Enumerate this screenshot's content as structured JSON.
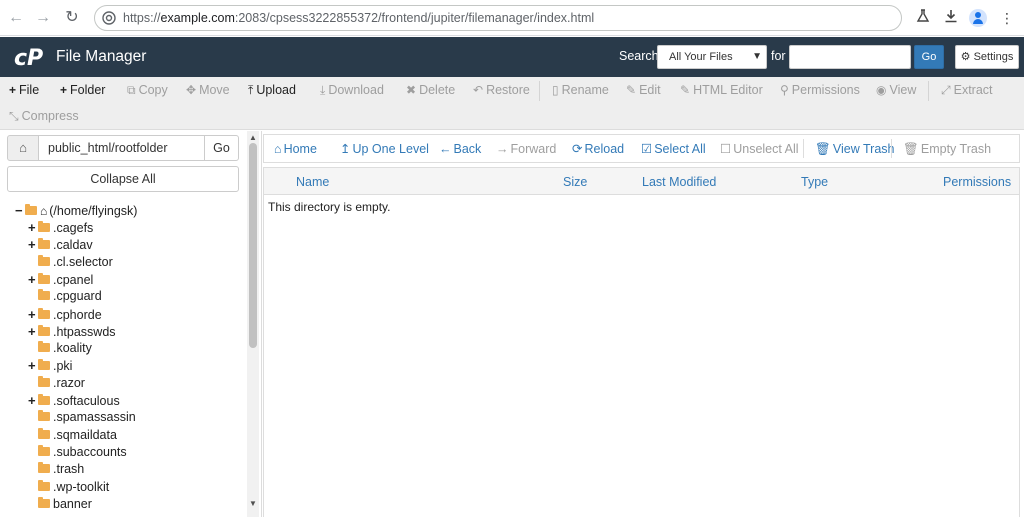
{
  "browser": {
    "url_prefix": "https://",
    "url_host": "example.com",
    "url_rest": ":2083/cpsess3222855372/frontend/jupiter/filemanager/index.html"
  },
  "header": {
    "title": "File Manager",
    "search_label": "Search",
    "search_scope": "All Your Files",
    "for_label": "for",
    "search_value": "",
    "go_label": "Go",
    "settings_label": "Settings"
  },
  "toolbar": {
    "file": "File",
    "folder": "Folder",
    "copy": "Copy",
    "move": "Move",
    "upload": "Upload",
    "download": "Download",
    "delete": "Delete",
    "restore": "Restore",
    "rename": "Rename",
    "edit": "Edit",
    "html_editor": "HTML Editor",
    "permissions": "Permissions",
    "view": "View",
    "extract": "Extract",
    "compress": "Compress"
  },
  "sidebar": {
    "path_value": "public_html/rootfolder",
    "go_label": "Go",
    "collapse_all": "Collapse All",
    "root": "(/home/flyingsk)",
    "items": [
      {
        "label": ".cagefs",
        "expandable": true
      },
      {
        "label": ".caldav",
        "expandable": true
      },
      {
        "label": ".cl.selector",
        "expandable": false
      },
      {
        "label": ".cpanel",
        "expandable": true
      },
      {
        "label": ".cpguard",
        "expandable": false
      },
      {
        "label": ".cphorde",
        "expandable": true
      },
      {
        "label": ".htpasswds",
        "expandable": true
      },
      {
        "label": ".koality",
        "expandable": false
      },
      {
        "label": ".pki",
        "expandable": true
      },
      {
        "label": ".razor",
        "expandable": false
      },
      {
        "label": ".softaculous",
        "expandable": true
      },
      {
        "label": ".spamassassin",
        "expandable": false
      },
      {
        "label": ".sqmaildata",
        "expandable": false
      },
      {
        "label": ".subaccounts",
        "expandable": false
      },
      {
        "label": ".trash",
        "expandable": false
      },
      {
        "label": ".wp-toolkit",
        "expandable": false
      },
      {
        "label": "banner",
        "expandable": false
      }
    ]
  },
  "navbar": {
    "home": "Home",
    "up_one_level": "Up One Level",
    "back": "Back",
    "forward": "Forward",
    "reload": "Reload",
    "select_all": "Select All",
    "unselect_all": "Unselect All",
    "view_trash": "View Trash",
    "empty_trash": "Empty Trash"
  },
  "table": {
    "columns": [
      "Name",
      "Size",
      "Last Modified",
      "Type",
      "Permissions"
    ],
    "empty_message": "This directory is empty."
  },
  "colors": {
    "header_bg": "#293a4a",
    "accent": "#337ab7",
    "folder": "#f0ad4e"
  }
}
